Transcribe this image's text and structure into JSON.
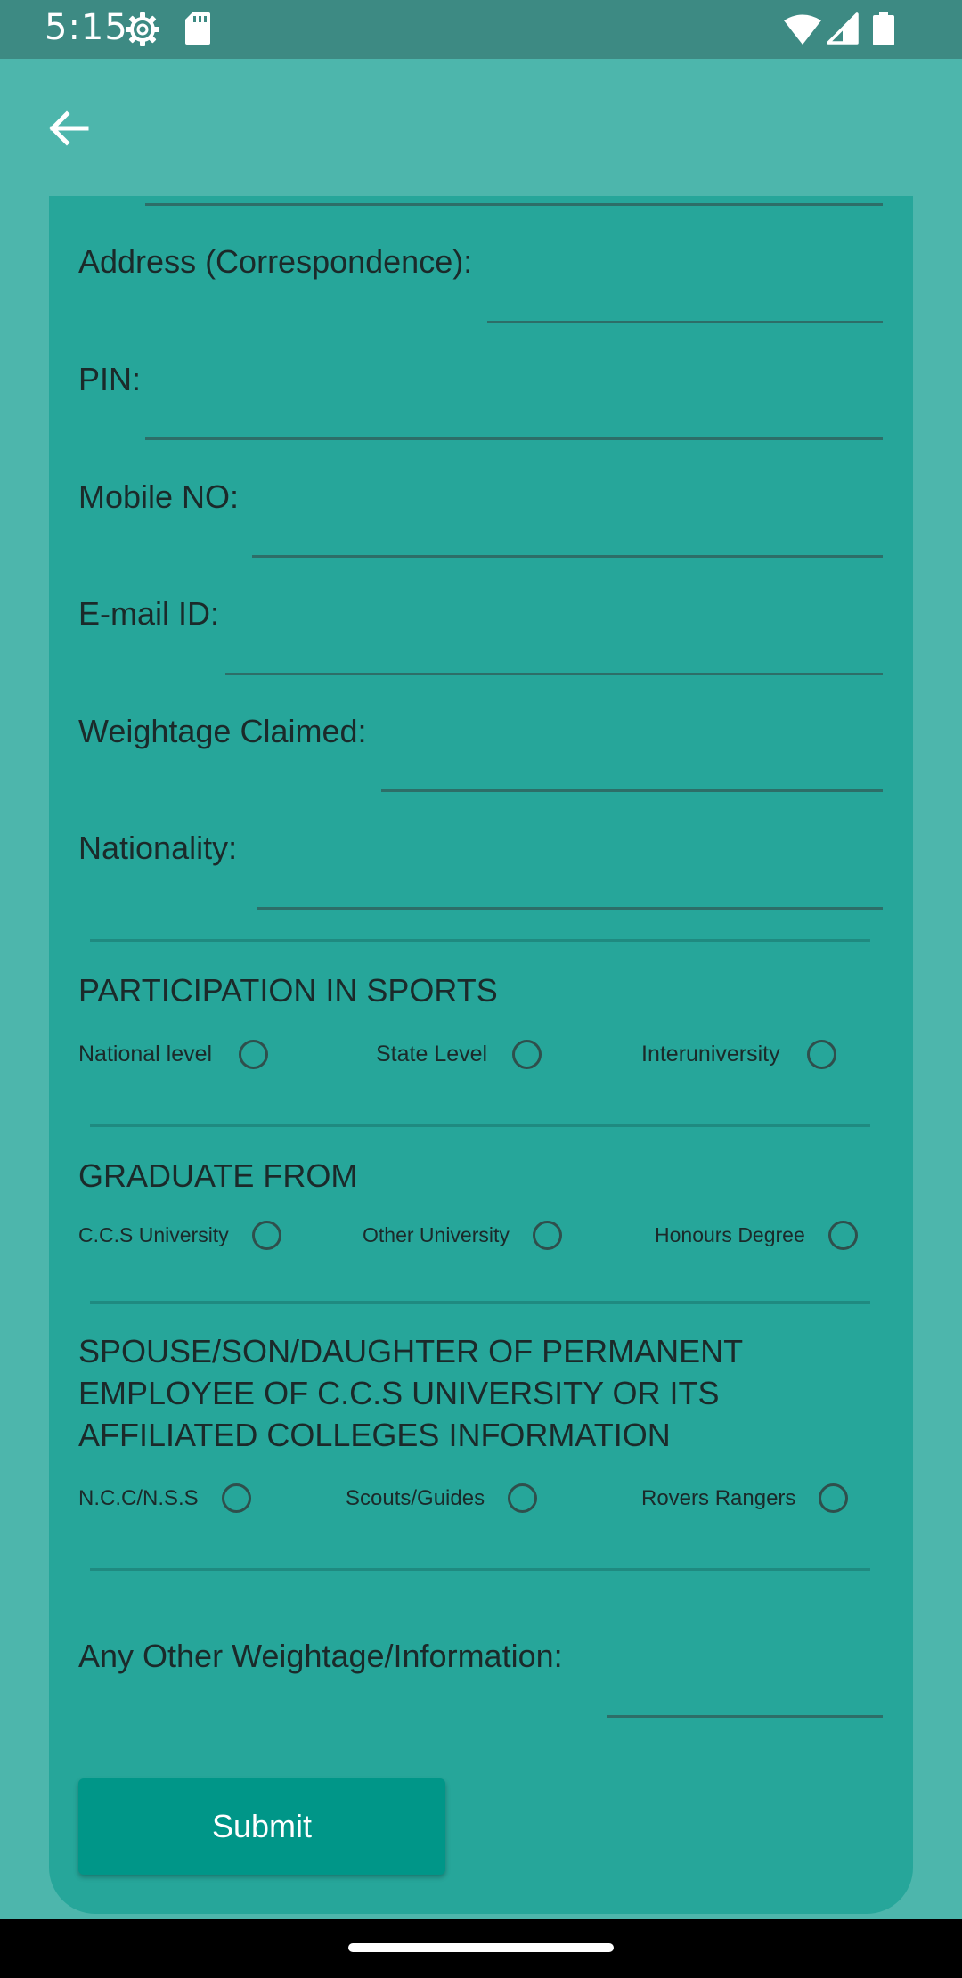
{
  "status_bar": {
    "time": "5:15"
  },
  "form": {
    "fields": [
      {
        "label": "Address (Correspondence):"
      },
      {
        "label": "PIN:"
      },
      {
        "label": "Mobile NO:"
      },
      {
        "label": "E-mail ID:"
      },
      {
        "label": "Weightage Claimed:"
      },
      {
        "label": "Nationality:"
      }
    ],
    "sports": {
      "title": "PARTICIPATION IN SPORTS",
      "options": [
        "National level",
        "State Level",
        "Interuniversity"
      ]
    },
    "graduate": {
      "title": "GRADUATE FROM",
      "options": [
        "C.C.S University",
        "Other University",
        "Honours Degree"
      ]
    },
    "spouse": {
      "title": "SPOUSE/SON/DAUGHTER OF PERMANENT EMPLOYEE OF C.C.S UNIVERSITY OR ITS AFFILIATED COLLEGES INFORMATION",
      "options": [
        "N.C.C/N.S.S",
        "Scouts/Guides",
        "Rovers Rangers"
      ]
    },
    "other_label": "Any Other Weightage/Information:",
    "submit_label": "Submit"
  },
  "icons": {
    "back": "arrow-left-icon",
    "status": [
      "gear-icon",
      "sd-card-icon",
      "wifi-icon",
      "cell-signal-icon",
      "battery-icon"
    ]
  },
  "colors": {
    "status_bar": "#3d8a83",
    "app_background": "#4db6ac",
    "card": "#26a69a",
    "button": "#009688"
  }
}
